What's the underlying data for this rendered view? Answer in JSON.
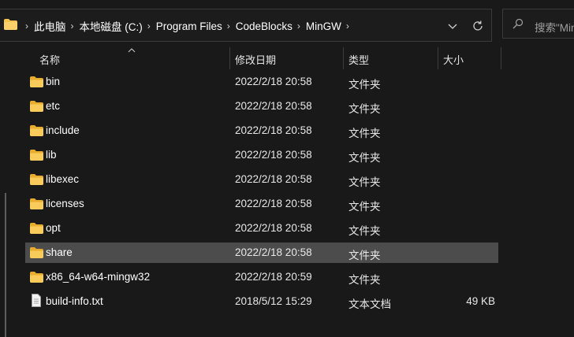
{
  "address_bar": {
    "breadcrumbs": [
      "此电脑",
      "本地磁盘 (C:)",
      "Program Files",
      "CodeBlocks",
      "MinGW"
    ]
  },
  "search": {
    "placeholder": "搜索\"Min"
  },
  "columns": {
    "name": "名称",
    "date": "修改日期",
    "type": "类型",
    "size": "大小"
  },
  "files": [
    {
      "name": "bin",
      "date": "2022/2/18 20:58",
      "type": "文件夹",
      "size": "",
      "icon": "folder-icon"
    },
    {
      "name": "etc",
      "date": "2022/2/18 20:58",
      "type": "文件夹",
      "size": "",
      "icon": "folder-icon"
    },
    {
      "name": "include",
      "date": "2022/2/18 20:58",
      "type": "文件夹",
      "size": "",
      "icon": "folder-icon"
    },
    {
      "name": "lib",
      "date": "2022/2/18 20:58",
      "type": "文件夹",
      "size": "",
      "icon": "folder-icon"
    },
    {
      "name": "libexec",
      "date": "2022/2/18 20:58",
      "type": "文件夹",
      "size": "",
      "icon": "folder-icon"
    },
    {
      "name": "licenses",
      "date": "2022/2/18 20:58",
      "type": "文件夹",
      "size": "",
      "icon": "folder-icon"
    },
    {
      "name": "opt",
      "date": "2022/2/18 20:58",
      "type": "文件夹",
      "size": "",
      "icon": "folder-icon"
    },
    {
      "name": "share",
      "date": "2022/2/18 20:58",
      "type": "文件夹",
      "size": "",
      "icon": "folder-icon",
      "selected": true
    },
    {
      "name": "x86_64-w64-mingw32",
      "date": "2022/2/18 20:59",
      "type": "文件夹",
      "size": "",
      "icon": "folder-icon"
    },
    {
      "name": "build-info.txt",
      "date": "2018/5/12 15:29",
      "type": "文本文档",
      "size": "49 KB",
      "icon": "text-file-icon"
    }
  ],
  "colors": {
    "background": "#191919",
    "selected_row": "#4c4c4c",
    "folder": "#f4c34e"
  }
}
